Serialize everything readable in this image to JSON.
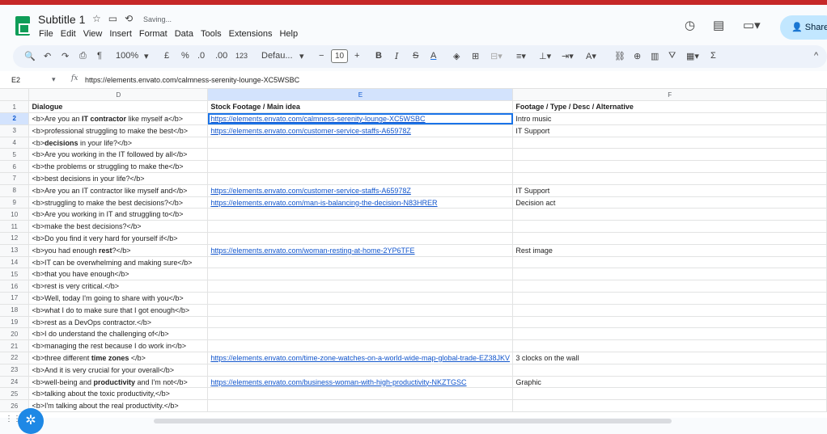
{
  "doc": {
    "title": "Subtitle 1",
    "status": "Saving...",
    "menu": [
      "File",
      "Edit",
      "View",
      "Insert",
      "Format",
      "Data",
      "Tools",
      "Extensions",
      "Help"
    ],
    "share_label": "Share"
  },
  "toolbar": {
    "zoom": "100%",
    "currency": "£",
    "percent": "%",
    "dec_decrease": ".0",
    "dec_increase": ".00",
    "number_format": "123",
    "font": "Defau...",
    "font_size": "10",
    "bold": "B",
    "italic": "I",
    "strike": "S",
    "text_color": "A",
    "sum": "Σ"
  },
  "formula_bar": {
    "cell_ref": "E2",
    "fx": "fx",
    "formula": "https://elements.envato.com/calmness-serenity-lounge-XC5WSBC"
  },
  "grid": {
    "columns": [
      "D",
      "E",
      "F"
    ],
    "rows": [
      {
        "n": "1",
        "d": "Dialogue",
        "e": "Stock Footage / Main idea",
        "f": "Footage / Type / Desc / Alternative"
      },
      {
        "n": "2",
        "d_parts": [
          "<b>Are you an ",
          "IT contractor",
          " like myself a</b>"
        ],
        "e": "https://elements.envato.com/calmness-serenity-lounge-XC5WSBC",
        "f": "Intro music"
      },
      {
        "n": "3",
        "d": "<b>professional struggling to make the best</b>",
        "e": "https://elements.envato.com/customer-service-staffs-A65978Z",
        "f": "IT Support"
      },
      {
        "n": "4",
        "d_parts": [
          "<b>",
          "decisions",
          " in your life?</b>"
        ],
        "e": "",
        "f": ""
      },
      {
        "n": "5",
        "d": "<b>Are you working in the IT followed by all</b>",
        "e": "",
        "f": ""
      },
      {
        "n": "6",
        "d": "<b>the problems or struggling to make the</b>",
        "e": "",
        "f": ""
      },
      {
        "n": "7",
        "d": "<b>best decisions in your life?</b>",
        "e": "",
        "f": ""
      },
      {
        "n": "8",
        "d": "<b>Are you an IT contractor like myself and</b>",
        "e": "https://elements.envato.com/customer-service-staffs-A65978Z",
        "f": "IT Support"
      },
      {
        "n": "9",
        "d": "<b>struggling to make the best decisions?</b>",
        "e": "https://elements.envato.com/man-is-balancing-the-decision-N83HRER",
        "f": "Decision act"
      },
      {
        "n": "10",
        "d": "<b>Are you working in IT and struggling to</b>",
        "e": "",
        "f": ""
      },
      {
        "n": "11",
        "d": "<b>make the best decisions?</b>",
        "e": "",
        "f": ""
      },
      {
        "n": "12",
        "d": "<b>Do you find it very hard for yourself if</b>",
        "e": "",
        "f": ""
      },
      {
        "n": "13",
        "d_parts": [
          "<b>you had enough ",
          "rest",
          "?</b>"
        ],
        "e": "https://elements.envato.com/woman-resting-at-home-2YP6TFE",
        "f": "Rest image"
      },
      {
        "n": "14",
        "d": "<b>IT can be overwhelming and making sure</b>",
        "e": "",
        "f": ""
      },
      {
        "n": "15",
        "d": "<b>that you have enough</b>",
        "e": "",
        "f": ""
      },
      {
        "n": "16",
        "d": "<b>rest is very critical.</b>",
        "e": "",
        "f": ""
      },
      {
        "n": "17",
        "d": "<b>Well, today I'm going to share with you</b>",
        "e": "",
        "f": ""
      },
      {
        "n": "18",
        "d": "<b>what I do to make sure that I got enough</b>",
        "e": "",
        "f": ""
      },
      {
        "n": "19",
        "d": "<b>rest as a DevOps contractor.</b>",
        "e": "",
        "f": ""
      },
      {
        "n": "20",
        "d": "<b>I do understand the challenging of</b>",
        "e": "",
        "f": ""
      },
      {
        "n": "21",
        "d": "<b>managing the rest because I do work in</b>",
        "e": "",
        "f": ""
      },
      {
        "n": "22",
        "d_parts": [
          "<b>three different ",
          "time zones",
          " </b>"
        ],
        "e": "https://elements.envato.com/time-zone-watches-on-a-world-wide-map-global-trade-EZ38JKV",
        "f": "3 clocks on the wall"
      },
      {
        "n": "23",
        "d": "<b>And it is very crucial for your overall</b>",
        "e": "",
        "f": ""
      },
      {
        "n": "24",
        "d_parts": [
          "<b>well-being and ",
          "productivity",
          " and I'm not</b>"
        ],
        "e": "https://elements.envato.com/business-woman-with-high-productivity-NKZTGSC",
        "f": "Graphic"
      },
      {
        "n": "25",
        "d": "<b>talking about the toxic productivity,</b>",
        "e": "",
        "f": ""
      },
      {
        "n": "26",
        "d": "<b>I'm talking about the real productivity.</b>",
        "e": "",
        "f": ""
      }
    ]
  }
}
